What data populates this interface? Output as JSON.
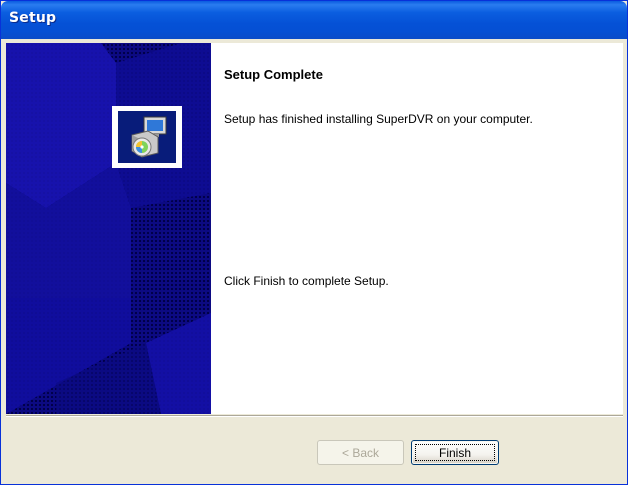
{
  "window": {
    "title": "Setup"
  },
  "wizard": {
    "heading": "Setup Complete",
    "message": "Setup has finished installing SuperDVR on your computer.",
    "instruction": "Click Finish to complete Setup."
  },
  "buttons": {
    "back_label": "< Back",
    "finish_label": "Finish"
  },
  "icons": {
    "setup": "setup-installer-icon"
  },
  "colors": {
    "titlebar": "#0551d6",
    "side_panel": "#0c0a82",
    "dialog_bg": "#ece9d8"
  }
}
